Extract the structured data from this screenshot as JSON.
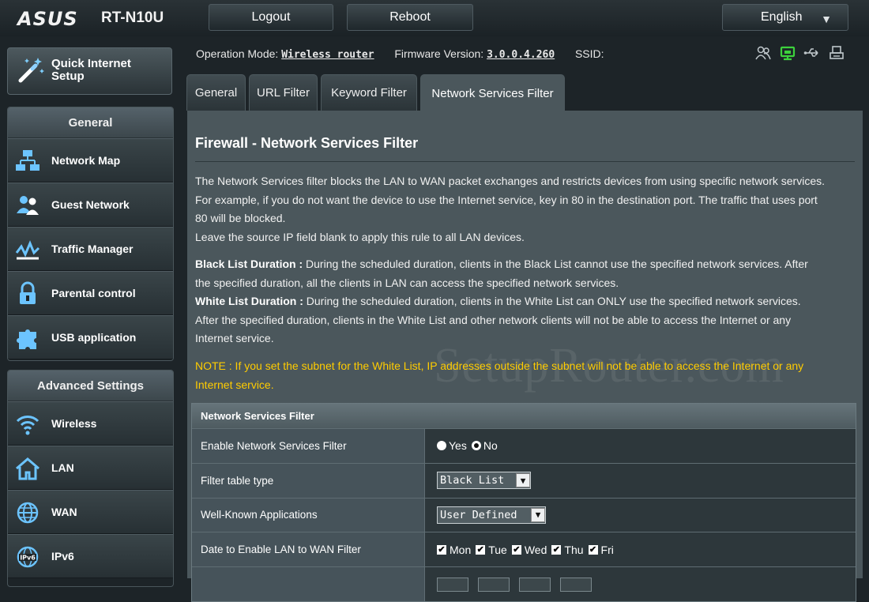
{
  "header": {
    "brand": "ASUS",
    "model": "RT-N10U",
    "logout_label": "Logout",
    "reboot_label": "Reboot",
    "language_label": "English"
  },
  "sidebar": {
    "quick_setup_label": "Quick Internet Setup",
    "general_title": "General",
    "general_items": [
      {
        "label": "Network Map",
        "icon": "network-map-icon"
      },
      {
        "label": "Guest Network",
        "icon": "guest-network-icon"
      },
      {
        "label": "Traffic Manager",
        "icon": "traffic-manager-icon"
      },
      {
        "label": "Parental control",
        "icon": "parental-lock-icon"
      },
      {
        "label": "USB application",
        "icon": "puzzle-icon"
      }
    ],
    "advanced_title": "Advanced Settings",
    "advanced_items": [
      {
        "label": "Wireless",
        "icon": "wifi-icon"
      },
      {
        "label": "LAN",
        "icon": "home-icon"
      },
      {
        "label": "WAN",
        "icon": "globe-icon"
      },
      {
        "label": "IPv6",
        "icon": "ipv6-globe-icon"
      }
    ]
  },
  "status": {
    "mode_label": "Operation Mode:",
    "mode_value": "Wireless router",
    "firmware_label": "Firmware Version:",
    "firmware_value": "3.0.0.4.260",
    "ssid_label": "SSID:",
    "icons": [
      "clients-icon",
      "network-status-icon",
      "usb-icon",
      "printer-icon"
    ],
    "active_icon_color": "#3cd13c"
  },
  "tabs": [
    {
      "label": "General",
      "active": false
    },
    {
      "label": "URL Filter",
      "active": false
    },
    {
      "label": "Keyword Filter",
      "active": false
    },
    {
      "label": "Network Services Filter",
      "active": true
    }
  ],
  "main": {
    "title": "Firewall - Network Services Filter",
    "intro": [
      "The Network Services filter blocks the LAN to WAN packet exchanges and restricts devices from using specific network services.",
      "For example, if you do not want the device to use the Internet service, key in 80 in the destination port. The traffic that uses port",
      "80 will be blocked.",
      "Leave the source IP field blank to apply this rule to all LAN devices."
    ],
    "black_term": "Black List Duration :",
    "black_line1": " During the scheduled duration, clients in the Black List cannot use the specified network services. After",
    "black_line2": "the specified duration, all the clients in LAN can access the specified network services.",
    "white_term": "White List Duration :",
    "white_line1": " During the scheduled duration, clients in the White List can ONLY use the specified network services.",
    "white_line2": "After the specified duration, clients in the White List and other network clients will not be able to access the Internet or any",
    "white_line3": "Internet service.",
    "note_line1": "NOTE : If you set the subnet for the White List, IP addresses outside the subnet will not be able to access the Internet or any",
    "note_line2": "Internet service.",
    "note_color": "#ffcc00",
    "watermark": "SetupRouter.com"
  },
  "filter_table": {
    "title": "Network Services Filter",
    "enable_label": "Enable Network Services Filter",
    "yes_label": "Yes",
    "no_label": "No",
    "enabled": false,
    "type_label": "Filter table type",
    "type_value": "Black List",
    "apps_label": "Well-Known Applications",
    "apps_value": "User Defined",
    "date_label": "Date to Enable LAN to WAN Filter",
    "days": [
      {
        "label": "Mon",
        "checked": true
      },
      {
        "label": "Tue",
        "checked": true
      },
      {
        "label": "Wed",
        "checked": true
      },
      {
        "label": "Thu",
        "checked": true
      },
      {
        "label": "Fri",
        "checked": true
      }
    ]
  }
}
